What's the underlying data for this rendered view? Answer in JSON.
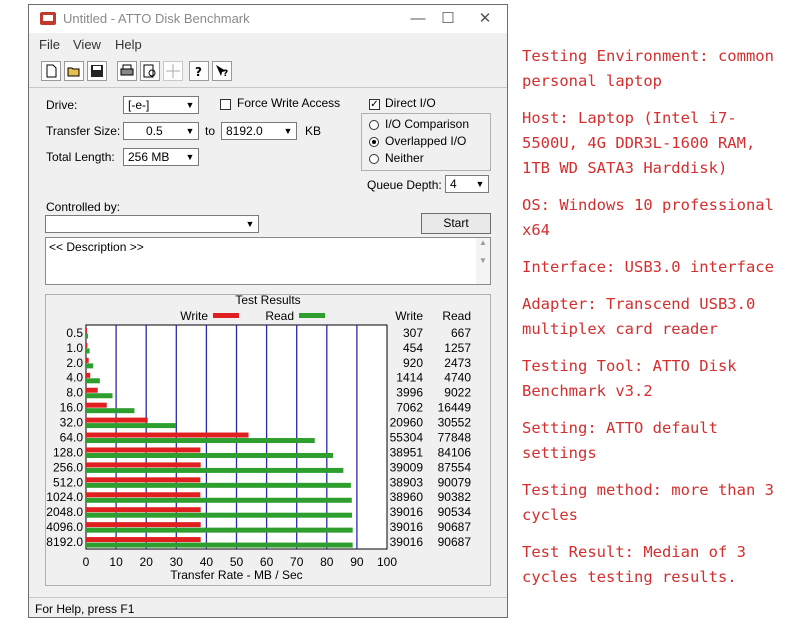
{
  "window": {
    "title": "Untitled - ATTO Disk Benchmark",
    "minimize": "—",
    "maximize": "☐",
    "close": "✕"
  },
  "menu": [
    "File",
    "View",
    "Help"
  ],
  "toolbar_icons": [
    "new-icon",
    "open-icon",
    "save-icon",
    "print-icon",
    "print-preview-icon",
    "move-icon",
    "help-icon",
    "context-help-icon"
  ],
  "form": {
    "drive_label": "Drive:",
    "drive_value": "[-e-]",
    "force_write_label": "Force Write Access",
    "force_write_checked": false,
    "direct_io_label": "Direct I/O",
    "direct_io_checked": true,
    "transfer_size_label": "Transfer Size:",
    "transfer_from": "0.5",
    "transfer_to_label": "to",
    "transfer_to": "8192.0",
    "transfer_unit": "KB",
    "total_length_label": "Total Length:",
    "total_length_value": "256 MB",
    "io_options": [
      {
        "label": "I/O Comparison",
        "selected": false
      },
      {
        "label": "Overlapped I/O",
        "selected": true
      },
      {
        "label": "Neither",
        "selected": false
      }
    ],
    "queue_depth_label": "Queue Depth:",
    "queue_depth_value": "4",
    "controlled_by_label": "Controlled by:",
    "controlled_by_value": "",
    "start_label": "Start",
    "description": "<< Description >>"
  },
  "colors": {
    "write": "#e02020",
    "read": "#2e9e2e",
    "grid": "#2a2aa8"
  },
  "chart_data": {
    "type": "bar",
    "title": "Test Results",
    "xlabel": "Transfer Rate - MB / Sec",
    "xlim": [
      0,
      100
    ],
    "xticks": [
      "0",
      "10",
      "20",
      "30",
      "40",
      "50",
      "60",
      "70",
      "80",
      "90",
      "100"
    ],
    "legend": [
      "Write",
      "Read"
    ],
    "column_headers": [
      "Write",
      "Read"
    ],
    "categories": [
      "0.5",
      "1.0",
      "2.0",
      "4.0",
      "8.0",
      "16.0",
      "32.0",
      "64.0",
      "128.0",
      "256.0",
      "512.0",
      "1024.0",
      "2048.0",
      "4096.0",
      "8192.0"
    ],
    "series": [
      {
        "name": "Write",
        "values": [
          0.3,
          0.45,
          0.9,
          1.4,
          3.9,
          6.9,
          20.5,
          54.0,
          38.0,
          38.1,
          38.0,
          38.0,
          38.1,
          38.1,
          38.1
        ],
        "labels": [
          "307",
          "454",
          "920",
          "1414",
          "3996",
          "7062",
          "20960",
          "55304",
          "38951",
          "39009",
          "38903",
          "38960",
          "39016",
          "39016",
          "39016"
        ]
      },
      {
        "name": "Read",
        "values": [
          0.65,
          1.2,
          2.4,
          4.6,
          8.8,
          16.1,
          29.8,
          76.0,
          82.1,
          85.5,
          88.0,
          88.3,
          88.4,
          88.6,
          88.6
        ],
        "labels": [
          "667",
          "1257",
          "2473",
          "4740",
          "9022",
          "16449",
          "30552",
          "77848",
          "84106",
          "87554",
          "90079",
          "90382",
          "90534",
          "90687",
          "90687"
        ]
      }
    ]
  },
  "status": "For Help, press F1",
  "notes": [
    "Testing Environment: common personal laptop",
    "Host: Laptop (Intel i7-5500U, 4G DDR3L-1600 RAM, 1TB WD SATA3 Harddisk)",
    "OS: Windows 10 professional x64",
    "Interface: USB3.0 interface",
    "Adapter: Transcend USB3.0 multiplex card reader",
    "Testing Tool: ATTO Disk Benchmark v3.2",
    "Setting: ATTO default settings",
    "Testing method: more than 3 cycles",
    "Test Result: Median of 3 cycles testing results."
  ]
}
